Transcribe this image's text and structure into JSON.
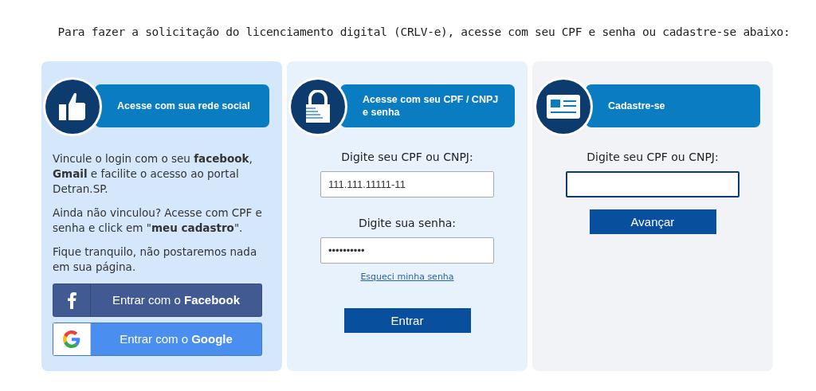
{
  "intro": "Para fazer a solicitação do licenciamento digital (CRLV-e), acesse com seu CPF e senha ou cadastre-se abaixo:",
  "cards": [
    {
      "kind": "social",
      "title": "Acesse com sua rede social",
      "paragraphs": [
        "Vincule o login com o seu **facebook**, **Gmail** e facilite o acesso ao portal Detran.SP.",
        "Ainda não vinculou? Acesse com CPF e senha e click em \"**meu cadastro**\".",
        "Fique tranquilo, não postaremos nada em sua página."
      ],
      "buttons": [
        {
          "kind": "facebook",
          "label": "Entrar com o **Facebook**"
        },
        {
          "kind": "google",
          "label": "Entrar com o **Google**"
        }
      ]
    },
    {
      "kind": "login",
      "title": "Acesse com seu CPF / CNPJ e senha",
      "fields": [
        {
          "label": "Digite seu CPF ou CNPJ:",
          "value": "111.111.11111-11",
          "focused": false
        },
        {
          "label": "Digite sua senha:",
          "value": "••••••••••",
          "focused": false
        }
      ],
      "link": "Esqueci minha senha",
      "button": "Entrar"
    },
    {
      "kind": "register",
      "title": "Cadastre-se",
      "fields": [
        {
          "label": "Digite seu CPF ou CNPJ:",
          "focused": true
        }
      ],
      "button": "Avançar"
    }
  ]
}
